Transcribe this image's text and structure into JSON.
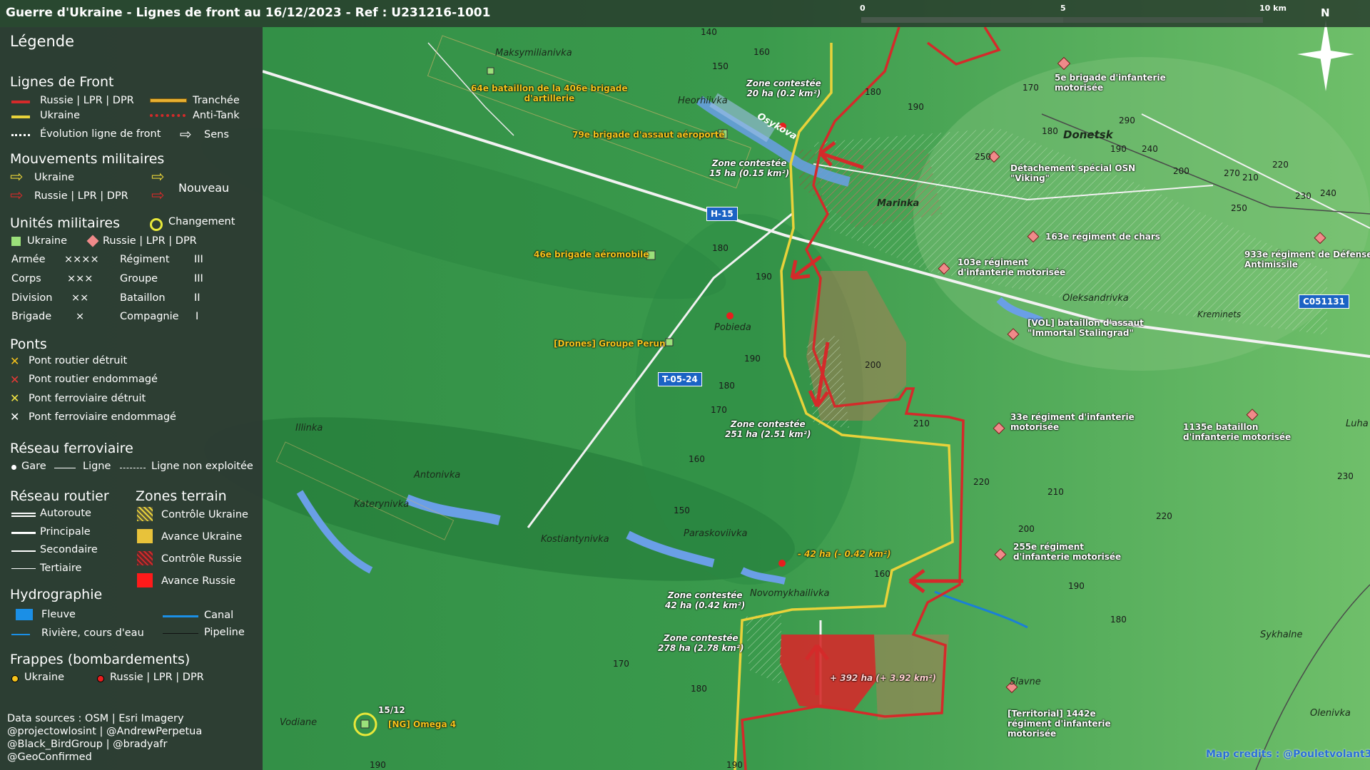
{
  "header": {
    "title": "Guerre d'Ukraine - Lignes de front au 16/12/2023 - Ref : U231216-1001"
  },
  "scale_bar": {
    "ticks": [
      "0",
      "5",
      "10 km"
    ]
  },
  "north_label": "N",
  "colors": {
    "russia": "#d42a2a",
    "ukraine": "#e8d23a",
    "ukraine_unit": "#9be07a",
    "russia_unit": "#f08a8a",
    "river": "#6a9fe6",
    "road_badge": "#1b63c4"
  },
  "legend": {
    "title": "Légende",
    "front_lines": {
      "heading": "Lignes de Front",
      "russia": "Russie | LPR | DPR",
      "ukraine": "Ukraine",
      "evolution": "Évolution ligne de front",
      "trench": "Tranchée",
      "anti_tank": "Anti-Tank",
      "direction": "Sens"
    },
    "movements": {
      "heading": "Mouvements militaires",
      "ukraine": "Ukraine",
      "russia": "Russie | LPR | DPR",
      "new": "Nouveau"
    },
    "units": {
      "heading": "Unités militaires",
      "change": "Changement",
      "ukraine": "Ukraine",
      "russia": "Russie | LPR | DPR",
      "rows": [
        {
          "name": "Armée",
          "sym": "××××",
          "name2": "Régiment",
          "sym2": "III"
        },
        {
          "name": "Corps",
          "sym": "×××",
          "name2": "Groupe",
          "sym2": "III"
        },
        {
          "name": "Division",
          "sym": "××",
          "name2": "Bataillon",
          "sym2": "II"
        },
        {
          "name": "Brigade",
          "sym": "×",
          "name2": "Compagnie",
          "sym2": "I"
        }
      ]
    },
    "bridges": {
      "heading": "Ponts",
      "items": [
        {
          "label": "Pont routier détruit",
          "color": "#f5c21b"
        },
        {
          "label": "Pont routier endommagé",
          "color": "#e53935"
        },
        {
          "label": "Pont ferroviaire détruit",
          "color": "#f5e642"
        },
        {
          "label": "Pont ferroviaire endommagé",
          "color": "#ffffff"
        }
      ]
    },
    "rail": {
      "heading": "Réseau ferroviaire",
      "station": "Gare",
      "line": "Ligne",
      "unused": "Ligne non exploitée"
    },
    "roads": {
      "heading": "Réseau routier",
      "items": [
        "Autoroute",
        "Principale",
        "Secondaire",
        "Tertiaire"
      ]
    },
    "terrain": {
      "heading": "Zones terrain",
      "items": [
        "Contrôle Ukraine",
        "Avance Ukraine",
        "Contrôle Russie",
        "Avance Russie"
      ]
    },
    "hydro": {
      "heading": "Hydrographie",
      "river": "Fleuve",
      "stream": "Rivière, cours d'eau",
      "canal": "Canal",
      "pipeline": "Pipeline"
    },
    "strikes": {
      "heading": "Frappes (bombardements)",
      "ukraine": "Ukraine",
      "russia": "Russie | LPR | DPR"
    },
    "sources": [
      "Data sources : OSM | Esri Imagery",
      "@projectowlosint | @AndrewPerpetua",
      "@Black_BirdGroup | @bradyafr",
      "@GeoConfirmed"
    ]
  },
  "towns": [
    {
      "name": "Maksymilianivka"
    },
    {
      "name": "Heorhiivka"
    },
    {
      "name": "Donetsk"
    },
    {
      "name": "Marinka"
    },
    {
      "name": "Oleksandrivka"
    },
    {
      "name": "Kreminets"
    },
    {
      "name": "Pobieda"
    },
    {
      "name": "Illinka"
    },
    {
      "name": "Antonivka"
    },
    {
      "name": "Katerynivka"
    },
    {
      "name": "Kostiantynivka"
    },
    {
      "name": "Paraskoviivka"
    },
    {
      "name": "Novomykhailivka"
    },
    {
      "name": "Slavne"
    },
    {
      "name": "Sykhalne"
    },
    {
      "name": "Olenivka"
    },
    {
      "name": "Vodiane"
    },
    {
      "name": "Luha"
    },
    {
      "name": "Osykova"
    }
  ],
  "units_ukraine": [
    {
      "name": "64e bataillon de la 406e brigade\nd'artillerie"
    },
    {
      "name": "79e brigade d'assaut aéroporté"
    },
    {
      "name": "46e brigade aéromobile"
    },
    {
      "name": "[Drones] Groupe Perun"
    },
    {
      "name": "[NG] Omega 4",
      "date": "15/12"
    }
  ],
  "units_russia": [
    {
      "name": "5e brigade d'infanterie\nmotorisée"
    },
    {
      "name": "Détachement spécial OSN\n\"Viking\""
    },
    {
      "name": "163e régiment de chars"
    },
    {
      "name": "103e régiment\nd'infanterie motorisée"
    },
    {
      "name": "933e régiment de Défense\nAntimissile"
    },
    {
      "name": "[VOL] bataillon d'assaut\n\"Immortal Stalingrad\""
    },
    {
      "name": "33e régiment d'infanterie\nmotorisée"
    },
    {
      "name": "1135e bataillon\nd'infanterie motorisée"
    },
    {
      "name": "255e régiment\nd'infanterie motorisée"
    },
    {
      "name": "[Territorial] 1442e\nrégiment d'infanterie\nmotorisée"
    }
  ],
  "zones": [
    {
      "text": "Zone contestée\n20 ha (0.2 km²)"
    },
    {
      "text": "Zone contestée\n15 ha (0.15 km²)"
    },
    {
      "text": "Zone contestée\n251 ha (2.51 km²)"
    },
    {
      "text": "Zone contestée\n42 ha (0.42 km²)"
    },
    {
      "text": "Zone contestée\n278 ha (2.78 km²)"
    },
    {
      "text": "- 42 ha (- 0.42 km²)"
    },
    {
      "text": "+ 392 ha (+ 3.92 km²)"
    }
  ],
  "roads": [
    "H-15",
    "T-05-24",
    "C051131"
  ],
  "elevations": [
    "140",
    "160",
    "150",
    "180",
    "190",
    "170",
    "180",
    "290",
    "190",
    "240",
    "250",
    "200",
    "270",
    "210",
    "220",
    "230",
    "240",
    "250",
    "180",
    "190",
    "200",
    "190",
    "180",
    "170",
    "160",
    "150",
    "210",
    "220",
    "210",
    "230",
    "200",
    "220",
    "160",
    "190",
    "180",
    "170",
    "180",
    "190",
    "190"
  ],
  "credits": "Map credits : @Pouletvolant3"
}
